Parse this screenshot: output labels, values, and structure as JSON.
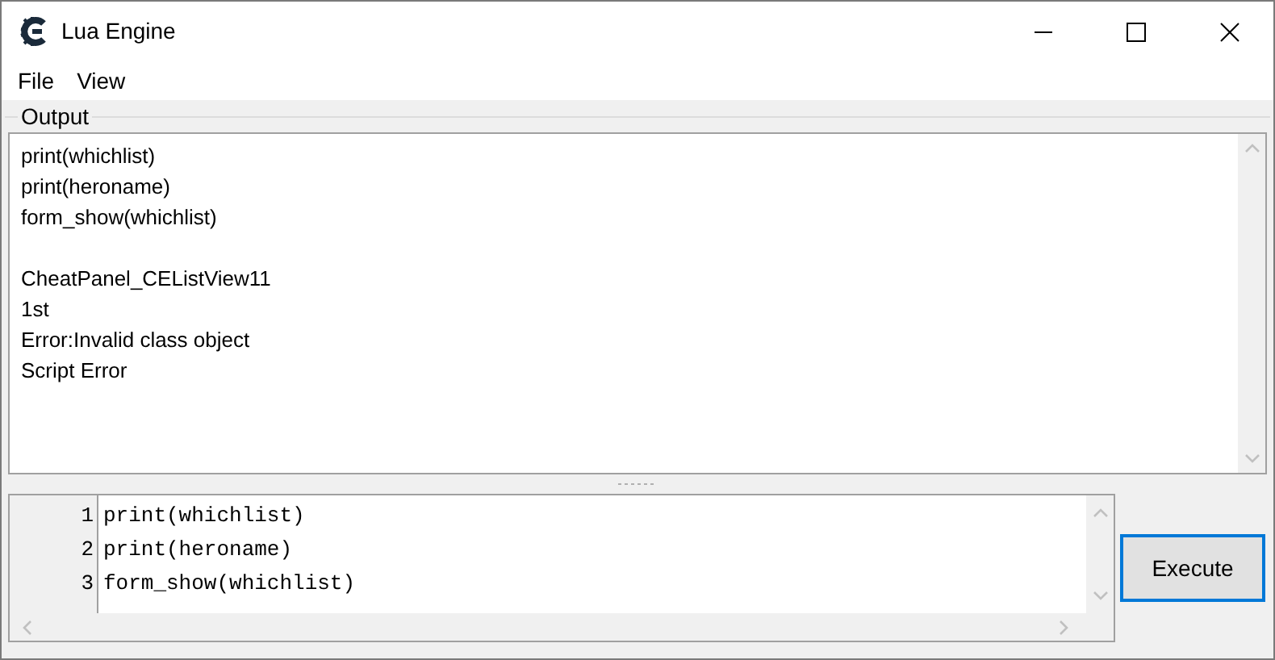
{
  "window": {
    "title": "Lua Engine"
  },
  "menu": [
    "File",
    "View"
  ],
  "output": {
    "label": "Output",
    "paragraphs": [
      [
        "print(whichlist)",
        "print(heroname)",
        "form_show(whichlist)"
      ],
      [
        "CheatPanel_CEListView11",
        "1st",
        "Error:Invalid class object",
        "Script Error"
      ]
    ]
  },
  "editor": {
    "lines": [
      {
        "number": "1",
        "code": "print(whichlist)"
      },
      {
        "number": "2",
        "code": "print(heroname)"
      },
      {
        "number": "3",
        "code": "form_show(whichlist)"
      }
    ]
  },
  "buttons": [
    "Execute"
  ]
}
